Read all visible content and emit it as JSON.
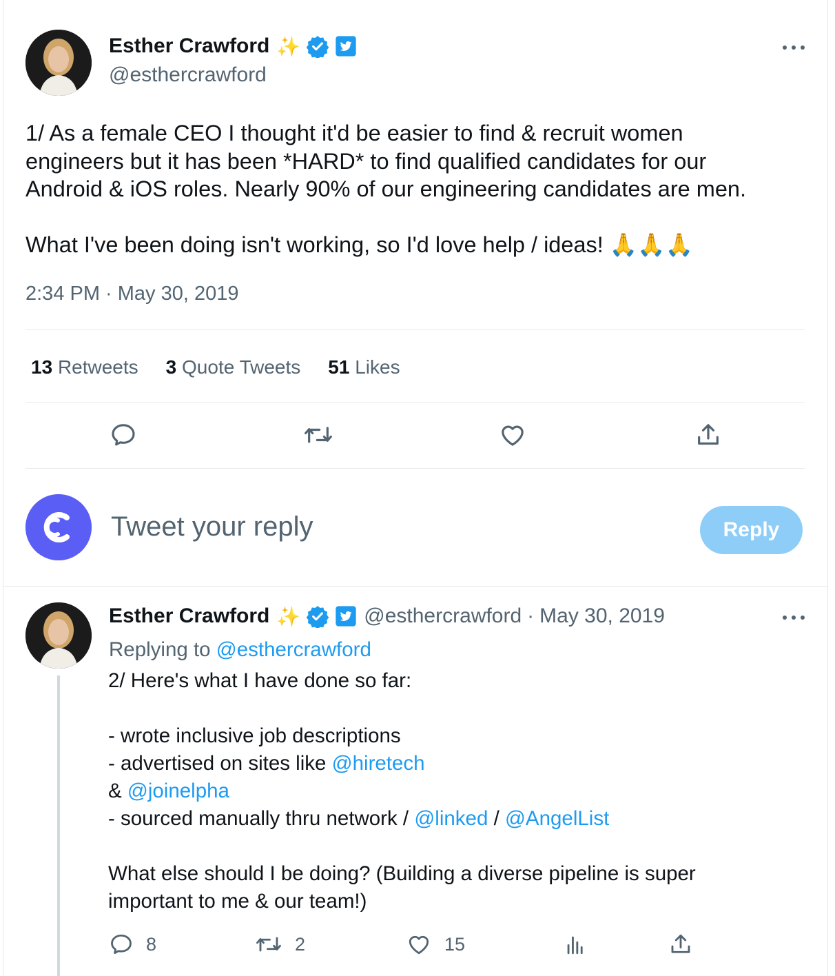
{
  "colors": {
    "accent": "#1d9bf0",
    "text": "#0f1419",
    "secondary": "#536471",
    "divider": "#e6e9ec",
    "reply_button_disabled": "#8ecdf8",
    "reply_avatar": "#5a5ef5"
  },
  "main_tweet": {
    "author_name": "Esther Crawford",
    "author_emoji": "✨",
    "author_handle": "@esthercrawford",
    "text_line1": "1/ As a female CEO I thought it'd be easier to find & recruit women",
    "text_line2": "engineers but it has been *HARD* to find qualified candidates for our",
    "text_line3": "Android & iOS roles. Nearly 90% of our engineering candidates are men.",
    "text_line4": "What I've been doing isn't working, so I'd love help / ideas!",
    "text_emoji": "🙏🙏🙏",
    "timestamp": "2:34 PM · May 30, 2019",
    "stats": {
      "retweets_count": "13",
      "retweets_label": "Retweets",
      "quotes_count": "3",
      "quotes_label": "Quote Tweets",
      "likes_count": "51",
      "likes_label": "Likes"
    }
  },
  "reply_box": {
    "placeholder": "Tweet your reply",
    "button_label": "Reply"
  },
  "reply_tweet": {
    "author_name": "Esther Crawford",
    "author_emoji": "✨",
    "author_handle": "@esthercrawford",
    "separator": "·",
    "date": "May 30, 2019",
    "replying_label": "Replying to",
    "replying_handle": "@esthercrawford",
    "line1": "2/ Here's what I have done so far:",
    "line2": "- wrote inclusive job descriptions",
    "line3_prefix": "- advertised on sites like",
    "mention_hiretech": "@hiretech",
    "line4_prefix": "&",
    "mention_joinelpha": "@joinelpha",
    "line5_prefix": "- sourced manually thru network /",
    "mention_linked": "@linked",
    "line5_sep": "/",
    "mention_angellist": "@AngelList",
    "line6": "What else should I be doing? (Building a diverse pipeline is super",
    "line7": "important to me & our team!)",
    "actions": {
      "reply_count": "8",
      "retweet_count": "2",
      "like_count": "15"
    }
  },
  "icons": [
    "verified-badge-icon",
    "twitter-blue-icon",
    "more-icon",
    "reply-icon",
    "retweet-icon",
    "like-icon",
    "share-icon",
    "analytics-icon"
  ]
}
